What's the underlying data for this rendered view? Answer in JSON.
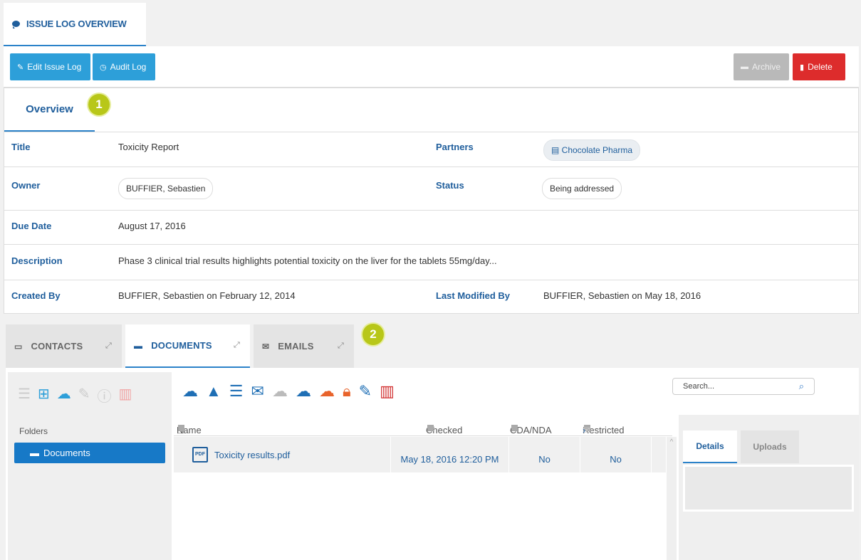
{
  "header": {
    "tab_label": "ISSUE LOG OVERVIEW"
  },
  "toolbar": {
    "edit_label": "Edit Issue Log",
    "audit_label": "Audit Log",
    "archive_label": "Archive",
    "delete_label": "Delete"
  },
  "overview": {
    "tab_label": "Overview",
    "marker": "1",
    "fields": {
      "title_label": "Title",
      "title_value": "Toxicity Report",
      "partners_label": "Partners",
      "partners_value": "Chocolate Pharma",
      "owner_label": "Owner",
      "owner_value": "BUFFIER, Sebastien",
      "status_label": "Status",
      "status_value": "Being addressed",
      "due_label": "Due Date",
      "due_value": "August 17, 2016",
      "description_label": "Description",
      "description_value": "Phase 3 clinical trial results highlights potential toxicity on the liver for the tablets 55mg/day...",
      "created_label": "Created By",
      "created_value": "BUFFIER, Sebastien on February 12, 2014",
      "modified_label": "Last Modified By",
      "modified_value": "BUFFIER, Sebastien on May 18, 2016"
    }
  },
  "bottom_tabs": {
    "contacts": "CONTACTS",
    "documents": "DOCUMENTS",
    "emails": "EMAILS",
    "marker": "2"
  },
  "documents": {
    "search_placeholder": "Search...",
    "folders_label": "Folders",
    "folder_selected": "Documents",
    "columns": {
      "name": "Name",
      "checked_in": "Checked in on",
      "cda": "CDA/NDA",
      "restricted": "Restricted"
    },
    "rows": [
      {
        "name": "Toxicity results.pdf",
        "checked_in": "May 18, 2016 12:20 PM",
        "cda": "No",
        "restricted": "No"
      }
    ],
    "right_tabs": {
      "details": "Details",
      "uploads": "Uploads"
    }
  },
  "colors": {
    "accent": "#2b82c9",
    "primary_button": "#2d9fd9",
    "delete": "#dd2c2c",
    "marker": "#b8c719"
  }
}
